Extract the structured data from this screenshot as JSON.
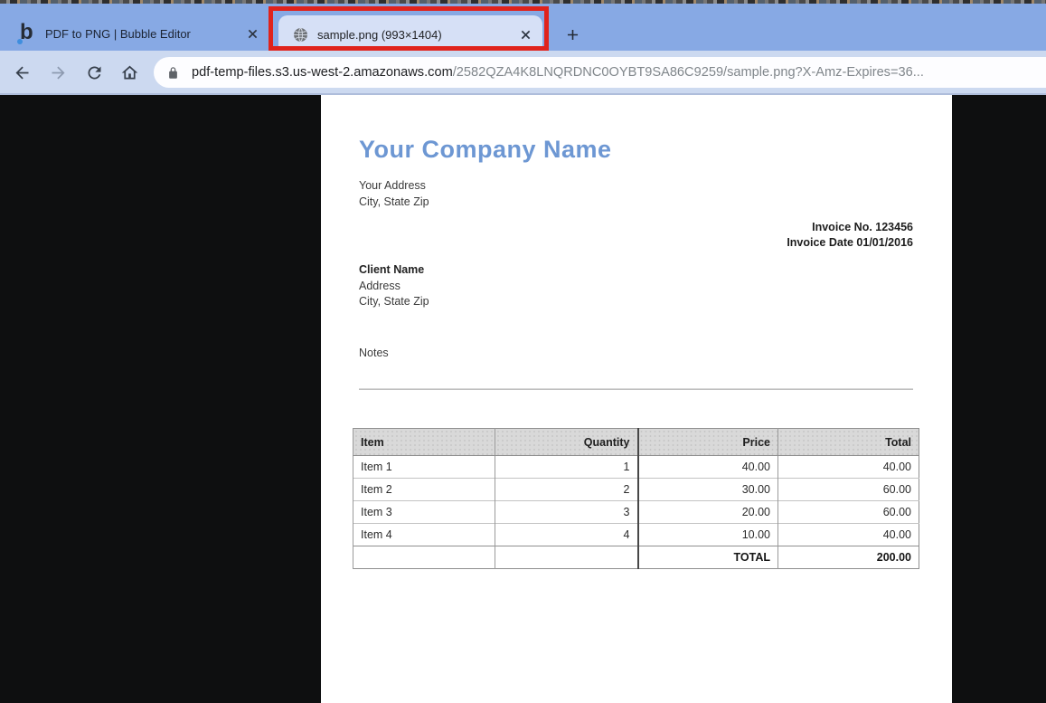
{
  "browser": {
    "tabs": [
      {
        "title": "PDF to PNG | Bubble Editor",
        "icon": "bubble-logo",
        "active": false
      },
      {
        "title": "sample.png (993×1404)",
        "icon": "globe",
        "active": true,
        "annotated": true
      }
    ],
    "url": {
      "domain": "pdf-temp-files.s3.us-west-2.amazonaws.com",
      "path": "/2582QZA4K8LNQRDNC0OYBT9SA86C9259/sample.png?X-Amz-Expires=36..."
    }
  },
  "invoice": {
    "company_name": "Your Company Name",
    "company_address": [
      "Your Address",
      "City, State Zip"
    ],
    "invoice_no": "Invoice No. 123456",
    "invoice_date": "Invoice Date 01/01/2016",
    "client_name": "Client Name",
    "client_address": [
      "Address",
      "City, State Zip"
    ],
    "notes_label": "Notes",
    "table": {
      "headers": [
        "Item",
        "Quantity",
        "Price",
        "Total"
      ],
      "rows": [
        [
          "Item 1",
          "1",
          "40.00",
          "40.00"
        ],
        [
          "Item 2",
          "2",
          "30.00",
          "60.00"
        ],
        [
          "Item 3",
          "3",
          "20.00",
          "60.00"
        ],
        [
          "Item 4",
          "4",
          "10.00",
          "40.00"
        ]
      ],
      "total_label": "TOTAL",
      "total_value": "200.00"
    }
  },
  "colors": {
    "tab_bar": "#87a9e4",
    "active_tab": "#d6e0f6",
    "toolbar": "#ccd9f0",
    "annotation_red": "#e0231c",
    "viewer_bg": "#0e0f10",
    "company_blue": "#6d97d3",
    "table_header_bg": "#d9d9d9"
  }
}
